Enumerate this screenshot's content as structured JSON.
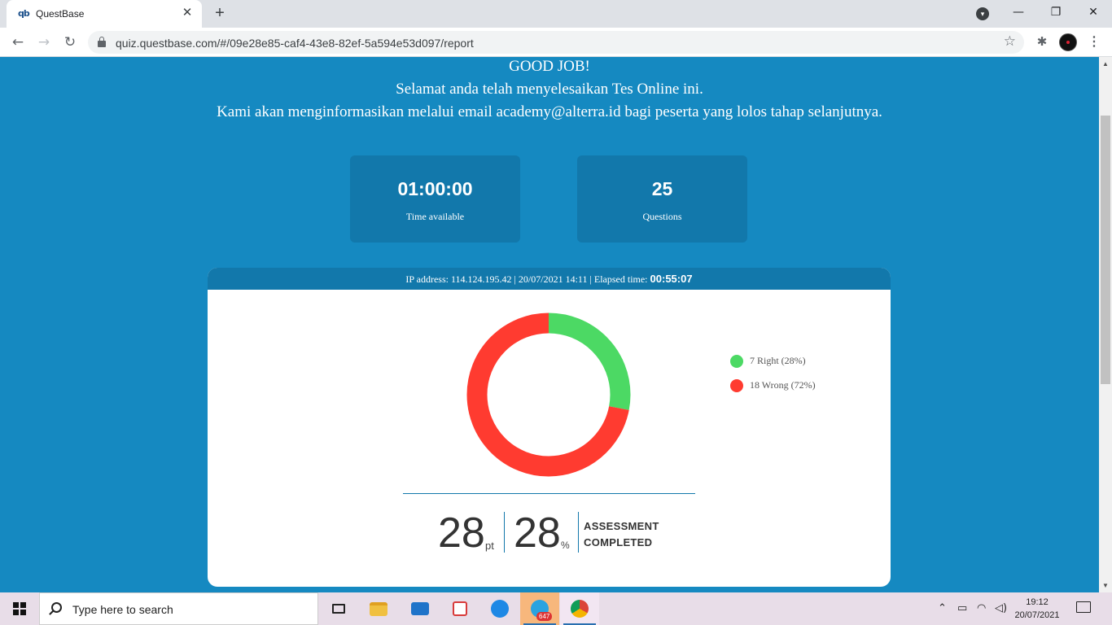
{
  "browser": {
    "tab_title": "QuestBase",
    "tab_favicon": "qb",
    "url": "quiz.questbase.com/#/09e28e85-caf4-43e8-82ef-5a594e53d097/report"
  },
  "report": {
    "headline": "GOOD JOB!",
    "message_1": "Selamat anda telah menyelesaikan Tes Online ini.",
    "message_2": "Kami akan menginformasikan melalui email academy@alterra.id bagi peserta yang lolos tahap selanjutnya.",
    "cards": [
      {
        "value": "01:00:00",
        "label": "Time available"
      },
      {
        "value": "25",
        "label": "Questions"
      }
    ],
    "meta_prefix": "IP address: 114.124.195.42 | 20/07/2021 14:11 | Elapsed time: ",
    "elapsed": "00:55:07",
    "chart": {
      "type": "pie",
      "slices": [
        {
          "label": "7 Right (28%)",
          "value": 7,
          "color": "#4cd964"
        },
        {
          "label": "18 Wrong (72%)",
          "value": 18,
          "color": "#ff3b30"
        }
      ]
    },
    "score_points": "28",
    "score_points_unit": "pt",
    "score_percent": "28",
    "score_percent_unit": "%",
    "status_line_1": "ASSESSMENT",
    "status_line_2": "COMPLETED"
  },
  "taskbar": {
    "search_placeholder": "Type here to search",
    "telegram_badge": "647",
    "time": "19:12",
    "date": "20/07/2021"
  },
  "colors": {
    "page_background": "#1589c1",
    "card_background": "#1278ab",
    "right": "#4cd964",
    "wrong": "#ff3b30"
  }
}
